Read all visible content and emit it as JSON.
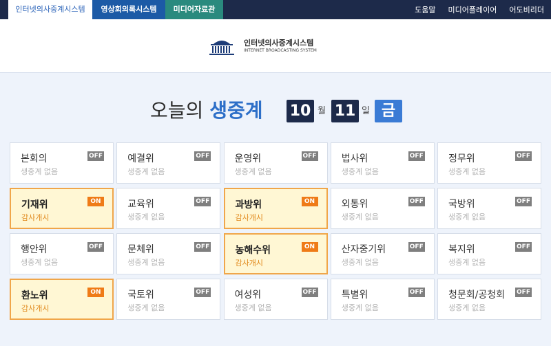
{
  "topnav": {
    "tabs": [
      {
        "label": "인터넷의사중계시스템"
      },
      {
        "label": "영상회의록시스템"
      },
      {
        "label": "미디어자료관"
      }
    ],
    "links": [
      {
        "label": "도움말"
      },
      {
        "label": "미디어플레이어"
      },
      {
        "label": "어도비리더"
      }
    ]
  },
  "header": {
    "logo_ko": "인터넷의사중계시스템",
    "logo_en": "INTERNET BROADCASTING SYSTEM"
  },
  "title": {
    "prefix": "오늘의 ",
    "accent": "생중계",
    "month": "10",
    "month_unit": "월",
    "day": "11",
    "day_unit": "일",
    "weekday": "금"
  },
  "committees": [
    {
      "name": "본회의",
      "status": "생중계 없음",
      "badge": "OFF",
      "on": false
    },
    {
      "name": "예결위",
      "status": "생중계 없음",
      "badge": "OFF",
      "on": false
    },
    {
      "name": "운영위",
      "status": "생중계 없음",
      "badge": "OFF",
      "on": false
    },
    {
      "name": "법사위",
      "status": "생중계 없음",
      "badge": "OFF",
      "on": false
    },
    {
      "name": "정무위",
      "status": "생중계 없음",
      "badge": "OFF",
      "on": false
    },
    {
      "name": "기재위",
      "status": "감사개시",
      "badge": "ON",
      "on": true
    },
    {
      "name": "교육위",
      "status": "생중계 없음",
      "badge": "OFF",
      "on": false
    },
    {
      "name": "과방위",
      "status": "감사개시",
      "badge": "ON",
      "on": true
    },
    {
      "name": "외통위",
      "status": "생중계 없음",
      "badge": "OFF",
      "on": false
    },
    {
      "name": "국방위",
      "status": "생중계 없음",
      "badge": "OFF",
      "on": false
    },
    {
      "name": "행안위",
      "status": "생중계 없음",
      "badge": "OFF",
      "on": false
    },
    {
      "name": "문체위",
      "status": "생중계 없음",
      "badge": "OFF",
      "on": false
    },
    {
      "name": "농해수위",
      "status": "감사개시",
      "badge": "ON",
      "on": true
    },
    {
      "name": "산자중기위",
      "status": "생중계 없음",
      "badge": "OFF",
      "on": false
    },
    {
      "name": "복지위",
      "status": "생중계 없음",
      "badge": "OFF",
      "on": false
    },
    {
      "name": "환노위",
      "status": "감사개시",
      "badge": "ON",
      "on": true
    },
    {
      "name": "국토위",
      "status": "생중계 없음",
      "badge": "OFF",
      "on": false
    },
    {
      "name": "여성위",
      "status": "생중계 없음",
      "badge": "OFF",
      "on": false
    },
    {
      "name": "특별위",
      "status": "생중계 없음",
      "badge": "OFF",
      "on": false
    },
    {
      "name": "청문회/공청회",
      "status": "생중계 없음",
      "badge": "OFF",
      "on": false
    }
  ],
  "colors": {
    "nav_bg": "#1d2a4a",
    "accent_blue": "#2d6fc8",
    "on_orange": "#ef7b17",
    "on_bg": "#fff7d4"
  }
}
